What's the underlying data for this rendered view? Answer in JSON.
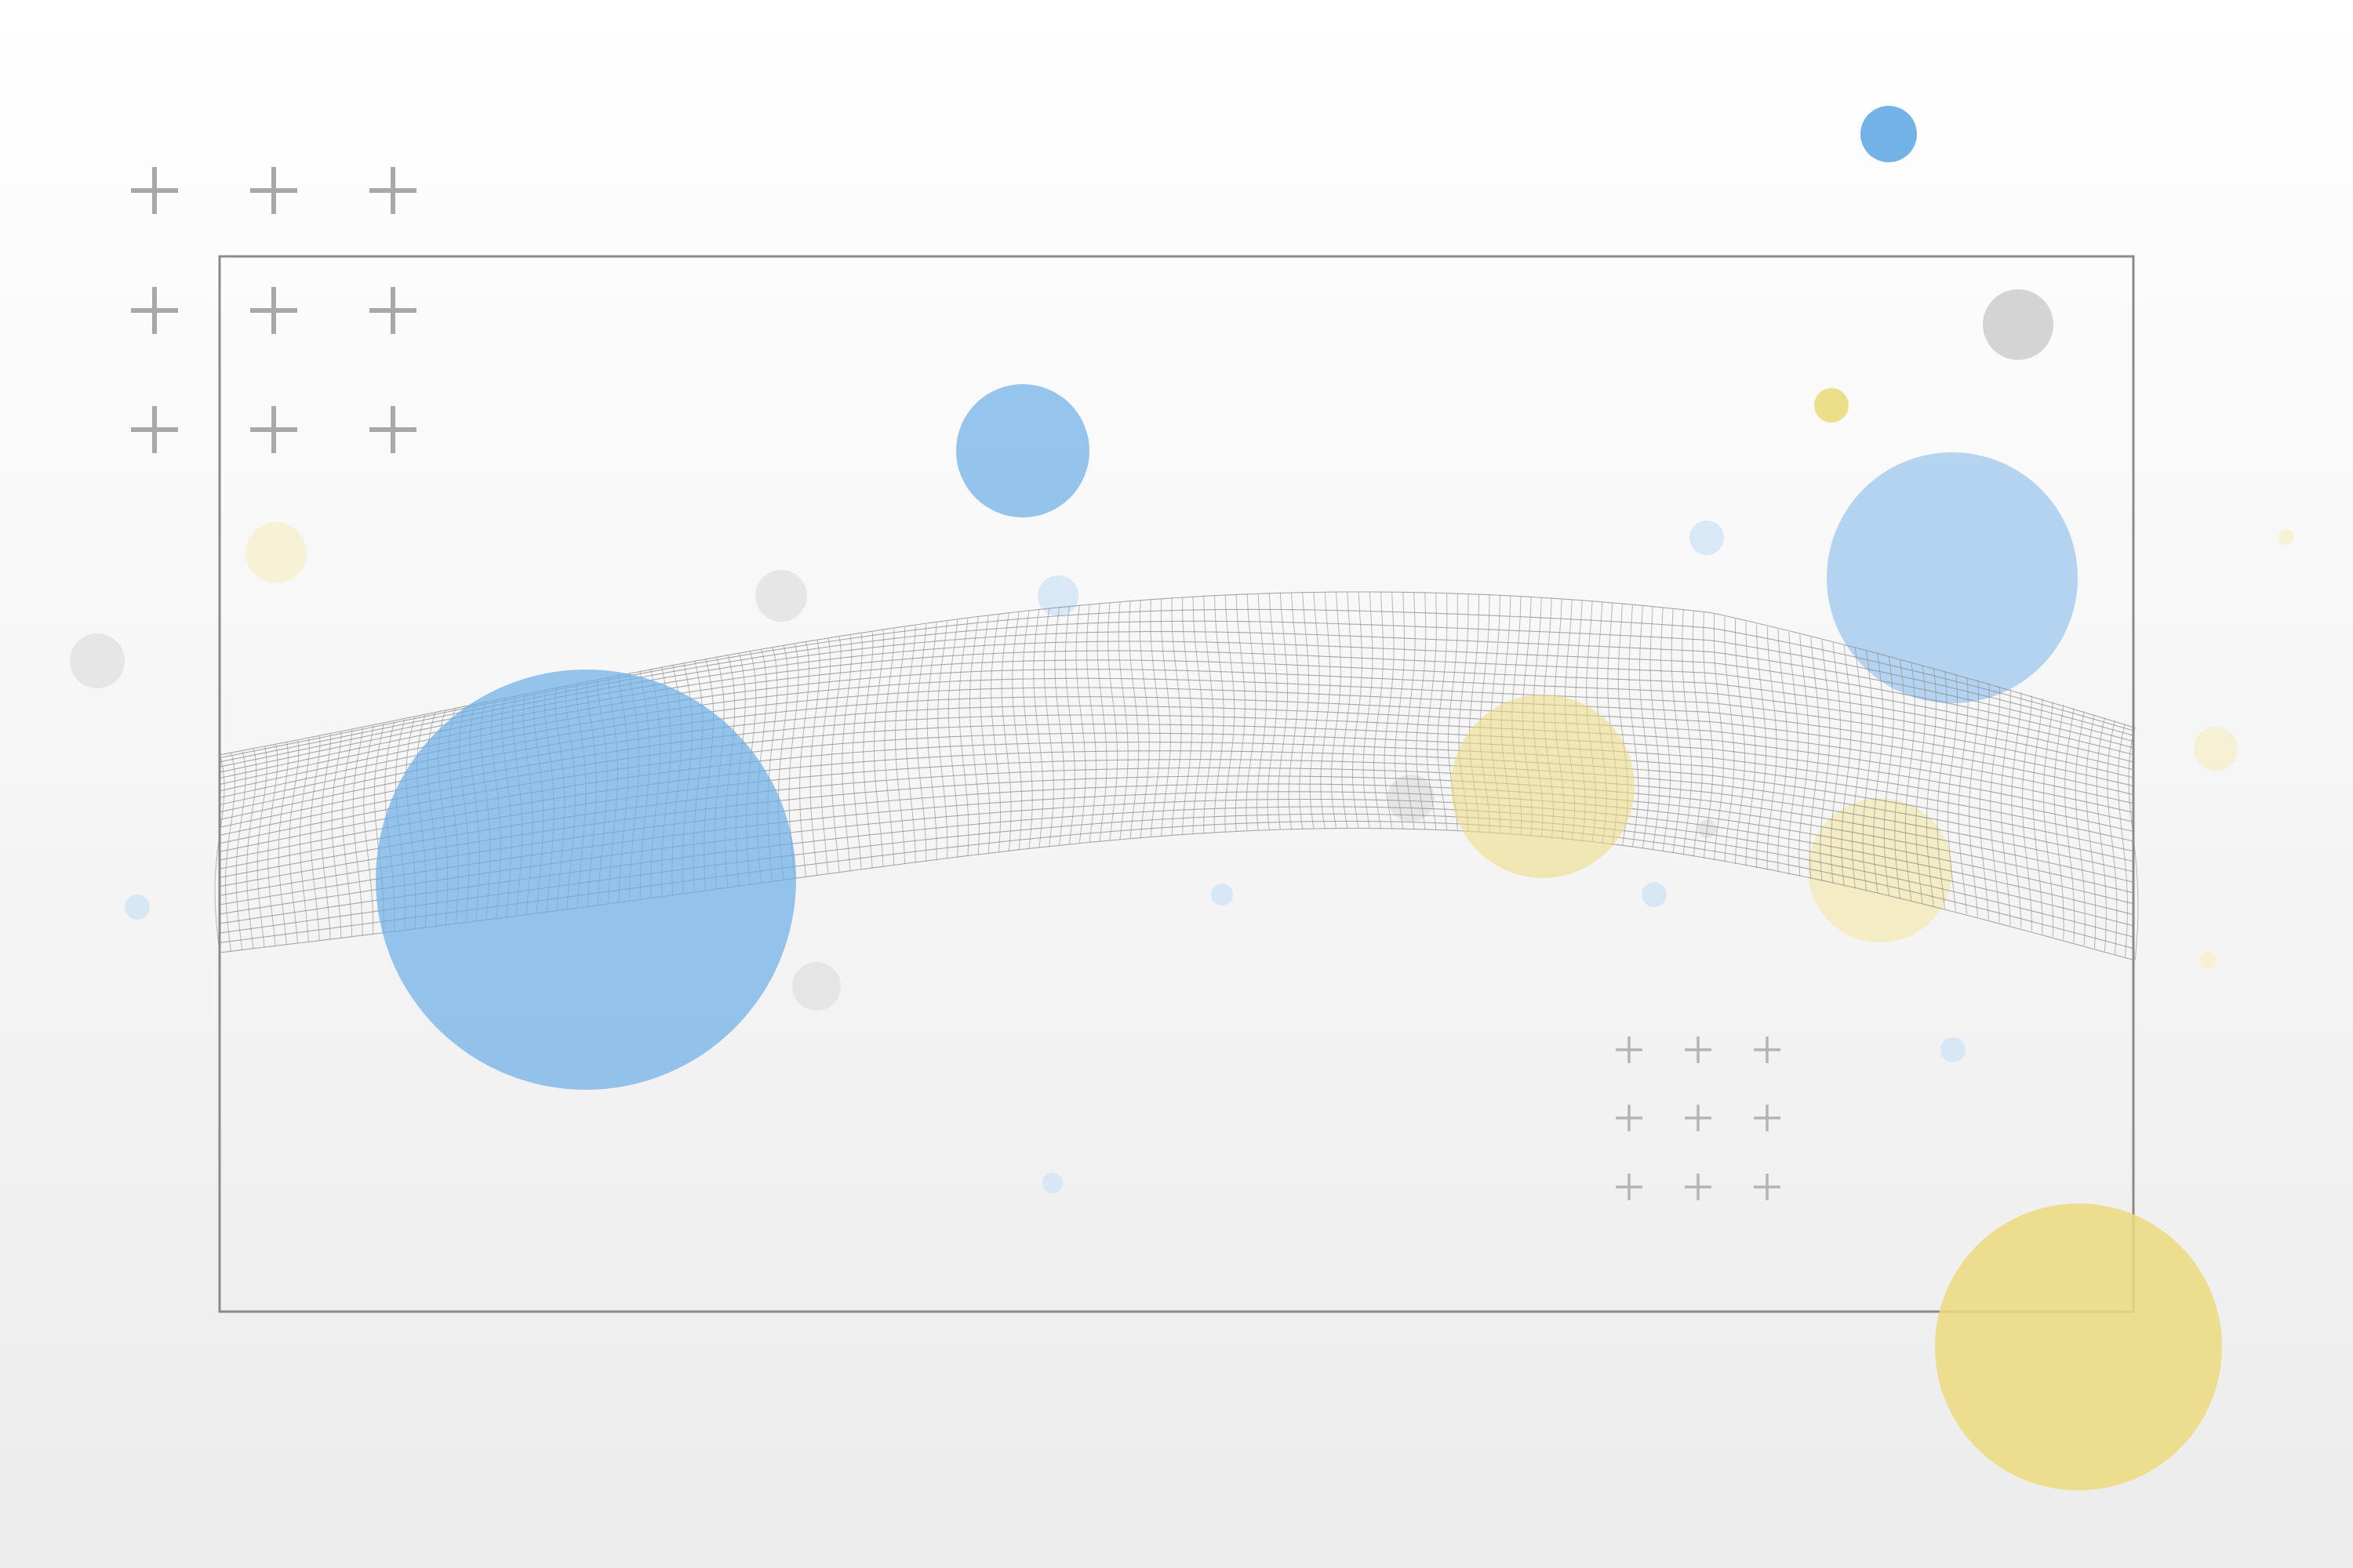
{
  "palette": {
    "background_top": "#ffffff",
    "background_bottom": "#ececec",
    "frame_stroke": "#8a8a8a",
    "mesh_stroke": "#8c8c8c",
    "cross_stroke": "#a8a8a8",
    "cross_small_stroke": "#b4b4b4",
    "blue": "#6aaee6",
    "blue_soft": "#a7cdee",
    "blue_faint": "#d4e5f5",
    "yellow": "#ebdb7d",
    "yellow_soft": "#f2eab8",
    "yellow_faint": "#f6f0d2",
    "gray": "#cccccc",
    "gray_faint": "#e3e3e3"
  },
  "icons": {
    "cross_icon": "plus-sign",
    "circle_icon": "filled-circle"
  }
}
